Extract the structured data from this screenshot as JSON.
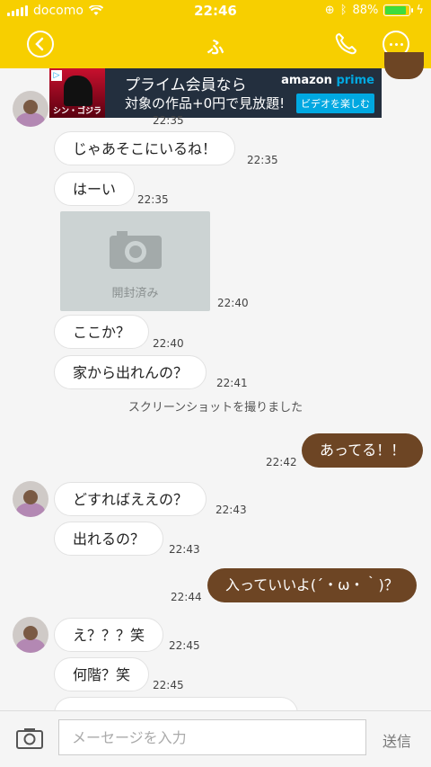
{
  "status": {
    "carrier": "docomo",
    "time": "22:46",
    "battery": "88%",
    "battery_level": 0.88
  },
  "header": {
    "title": "ふ"
  },
  "ad": {
    "line1": "プライム会員なら",
    "line2": "対象の作品+0円で見放題!",
    "brand_a": "amazon ",
    "brand_b": "prime",
    "cta": "ビデオを楽しむ",
    "poster_title": "シン・ゴジラ"
  },
  "messages": [
    {
      "text": "じゃあそこにいるね！",
      "time": "22:35"
    },
    {
      "text": "はーい",
      "time": "22:35"
    },
    {
      "text": "開封済み",
      "time": "22:40"
    },
    {
      "text": "ここか？",
      "time": "22:40"
    },
    {
      "text": "家から出れんの？",
      "time": "22:41"
    },
    {
      "text": "あってる！！",
      "time": "22:42"
    },
    {
      "text": "どすればええの？",
      "time": "22:43"
    },
    {
      "text": "出れるの？",
      "time": "22:43"
    },
    {
      "text": "入っていいよ(´・ω・｀)？",
      "time": "22:44"
    },
    {
      "text": "え？？？笑",
      "time": "22:45"
    },
    {
      "text": "何階？笑",
      "time": "22:45"
    }
  ],
  "first_ts": "22:35",
  "system_note": "スクリーンショットを撮りました",
  "composer": {
    "placeholder": "メーセージを入力",
    "send_label": "送信"
  },
  "colors": {
    "header_bg": "#f7cf00",
    "outgoing_bubble": "#6d4524",
    "incoming_bubble": "#ffffff"
  },
  "icons": [
    "back-icon",
    "phone-icon",
    "more-icon",
    "camera-icon",
    "wifi-icon",
    "battery-icon"
  ]
}
